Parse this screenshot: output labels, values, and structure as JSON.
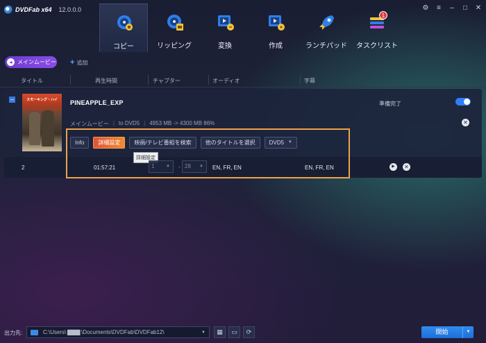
{
  "app": {
    "name": "DVDFab x64",
    "version": "12.0.0.0"
  },
  "nav": {
    "items": [
      {
        "label": "コピー",
        "icon": "copy-disc-icon",
        "active": true
      },
      {
        "label": "リッピング",
        "icon": "ripper-icon",
        "active": false
      },
      {
        "label": "変換",
        "icon": "converter-icon",
        "active": false
      },
      {
        "label": "作成",
        "icon": "creator-icon",
        "active": false
      },
      {
        "label": "ランチパッド",
        "icon": "launchpad-rocket-icon",
        "active": false
      },
      {
        "label": "タスクリスト",
        "icon": "task-list-icon",
        "active": false,
        "badge": "1"
      }
    ]
  },
  "mode": {
    "main_movie": "メインムービー",
    "add": "追加"
  },
  "columns": [
    "タイトル",
    "再生時間",
    "チャプター",
    "オーディオ",
    "字幕"
  ],
  "title_card": {
    "name": "PINEAPPLE_EXP",
    "status": "準備完了",
    "poster_text": "スモーキング・ハイ",
    "meta": {
      "mode": "メインムービー",
      "target": "to DVD5",
      "size": "4953 MB -> 4300 MB 86%"
    },
    "buttons": {
      "info": "Info",
      "advanced": "詳細設定",
      "search": "映画/テレビ番組を検索",
      "other_title": "他のタイトルを選択",
      "disc": "DVD5"
    },
    "tooltip": "詳細設定",
    "row": {
      "number": "2",
      "duration": "01:57:21",
      "chapter_start": "1",
      "chapter_end": "28",
      "audio": "EN, FR, EN",
      "subtitles": "EN, FR, EN"
    }
  },
  "output": {
    "label": "出力先:",
    "path": "C:\\Users\\ ▇▇▇ \\Documents\\DVDFab\\DVDFab12\\"
  },
  "start": {
    "label": "開始"
  },
  "colors": {
    "accent": "#2d7ff5",
    "highlight": "#f0a24a",
    "advanced_button": "#e0533a"
  }
}
